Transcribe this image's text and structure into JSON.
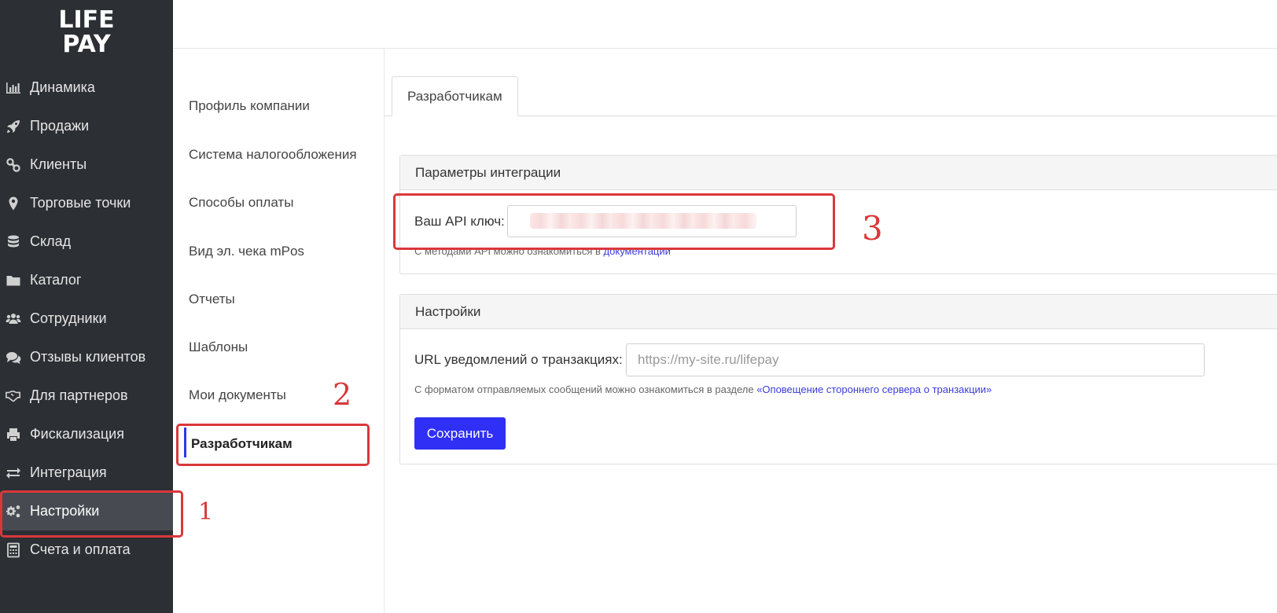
{
  "logo": {
    "line1": "LIFE",
    "line2": "PAY"
  },
  "sidebar": {
    "items": [
      {
        "label": "Динамика",
        "icon": "bar-chart-icon"
      },
      {
        "label": "Продажи",
        "icon": "rocket-icon"
      },
      {
        "label": "Клиенты",
        "icon": "link-icon"
      },
      {
        "label": "Торговые точки",
        "icon": "map-marker-icon"
      },
      {
        "label": "Склад",
        "icon": "database-icon"
      },
      {
        "label": "Каталог",
        "icon": "folder-icon"
      },
      {
        "label": "Сотрудники",
        "icon": "users-icon"
      },
      {
        "label": "Отзывы клиентов",
        "icon": "comments-icon"
      },
      {
        "label": "Для партнеров",
        "icon": "handshake-icon"
      },
      {
        "label": "Фискализация",
        "icon": "printer-icon"
      },
      {
        "label": "Интеграция",
        "icon": "exchange-icon"
      },
      {
        "label": "Настройки",
        "icon": "gears-icon",
        "active": true
      },
      {
        "label": "Счета и оплата",
        "icon": "calculator-icon"
      }
    ]
  },
  "subnav": {
    "items": [
      {
        "label": "Профиль компании"
      },
      {
        "label": "Система налогообложения"
      },
      {
        "label": "Способы оплаты"
      },
      {
        "label": "Вид эл. чека mPos"
      },
      {
        "label": "Отчеты"
      },
      {
        "label": "Шаблоны"
      },
      {
        "label": "Мои документы"
      },
      {
        "label": "Разработчикам",
        "active": true
      }
    ]
  },
  "tabs": [
    {
      "label": "Разработчикам"
    }
  ],
  "integration": {
    "title": "Параметры интеграции",
    "api_key_label": "Ваш API ключ:",
    "api_key_value": "",
    "hint_text": "С методами API можно ознакомиться в ",
    "hint_link": "документации"
  },
  "settings": {
    "title": "Настройки",
    "url_label": "URL уведомлений о транзакциях:",
    "url_placeholder": "https://my-site.ru/lifepay",
    "hint_text": "С форматом отправляемых сообщений можно ознакомиться в разделе ",
    "hint_link": "«Оповещение стороннего сервера о транзакции»",
    "save_label": "Сохранить"
  },
  "annotations": {
    "n1": "1",
    "n2": "2",
    "n3": "3",
    "color": "#d9383a"
  },
  "colors": {
    "sidebar_bg": "#2c2f33",
    "accent": "#2f2ff5",
    "active_item_bg": "#474b51"
  }
}
